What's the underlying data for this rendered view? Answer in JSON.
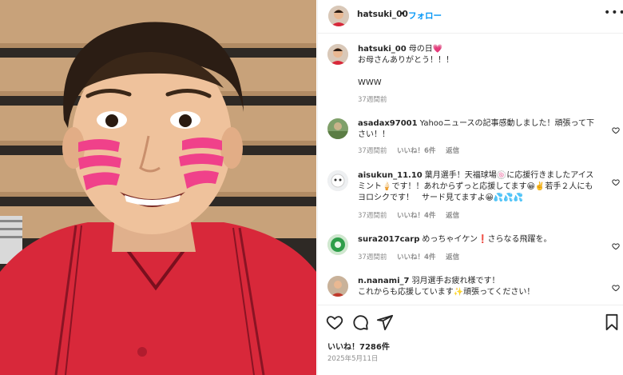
{
  "post": {
    "username": "hatsuki_00",
    "separator": "•",
    "follow_label": "フォロー",
    "more_label": "•••"
  },
  "caption": {
    "username": "hatsuki_00",
    "text": "母の日💗\nお母さんありがとう！！！\n\nWWW",
    "time": "37週間前"
  },
  "comments": [
    {
      "username": "asadax97001",
      "text": "Yahooニュースの記事感動しました！頑張って下さい！！",
      "time": "37週間前",
      "likes": "いいね！6件",
      "reply": "返信"
    },
    {
      "username": "aisukun_11.10",
      "text": "葉月選手！天福球場🍥に応援行きましたアイスミント🍦です！！あれからずっと応援してます😀✌️若手２人にもヨロシクです！　サード見てますよ😀💦💦💦",
      "time": "37週間前",
      "likes": "いいね！4件",
      "reply": "返信"
    },
    {
      "username": "sura2017carp",
      "text": "めっちゃイケン❗さらなる飛躍を。",
      "time": "37週間前",
      "likes": "いいね！4件",
      "reply": "返信"
    },
    {
      "username": "n.nanami_7",
      "text": "羽月選手お疲れ様です！\nこれからも応援しています✨頑張ってください！",
      "time": "",
      "likes": "",
      "reply": ""
    }
  ],
  "footer": {
    "likes": "いいね！7286件",
    "date": "2025年5月11日"
  },
  "icons": {
    "like": "heart-icon",
    "comment": "comment-icon",
    "share": "send-icon",
    "save": "bookmark-icon"
  },
  "colors": {
    "link_blue": "#0095f6",
    "secondary_text": "#8e8e8e",
    "jersey_red": "#d8283a",
    "face_paint_pink": "#f0418a"
  }
}
